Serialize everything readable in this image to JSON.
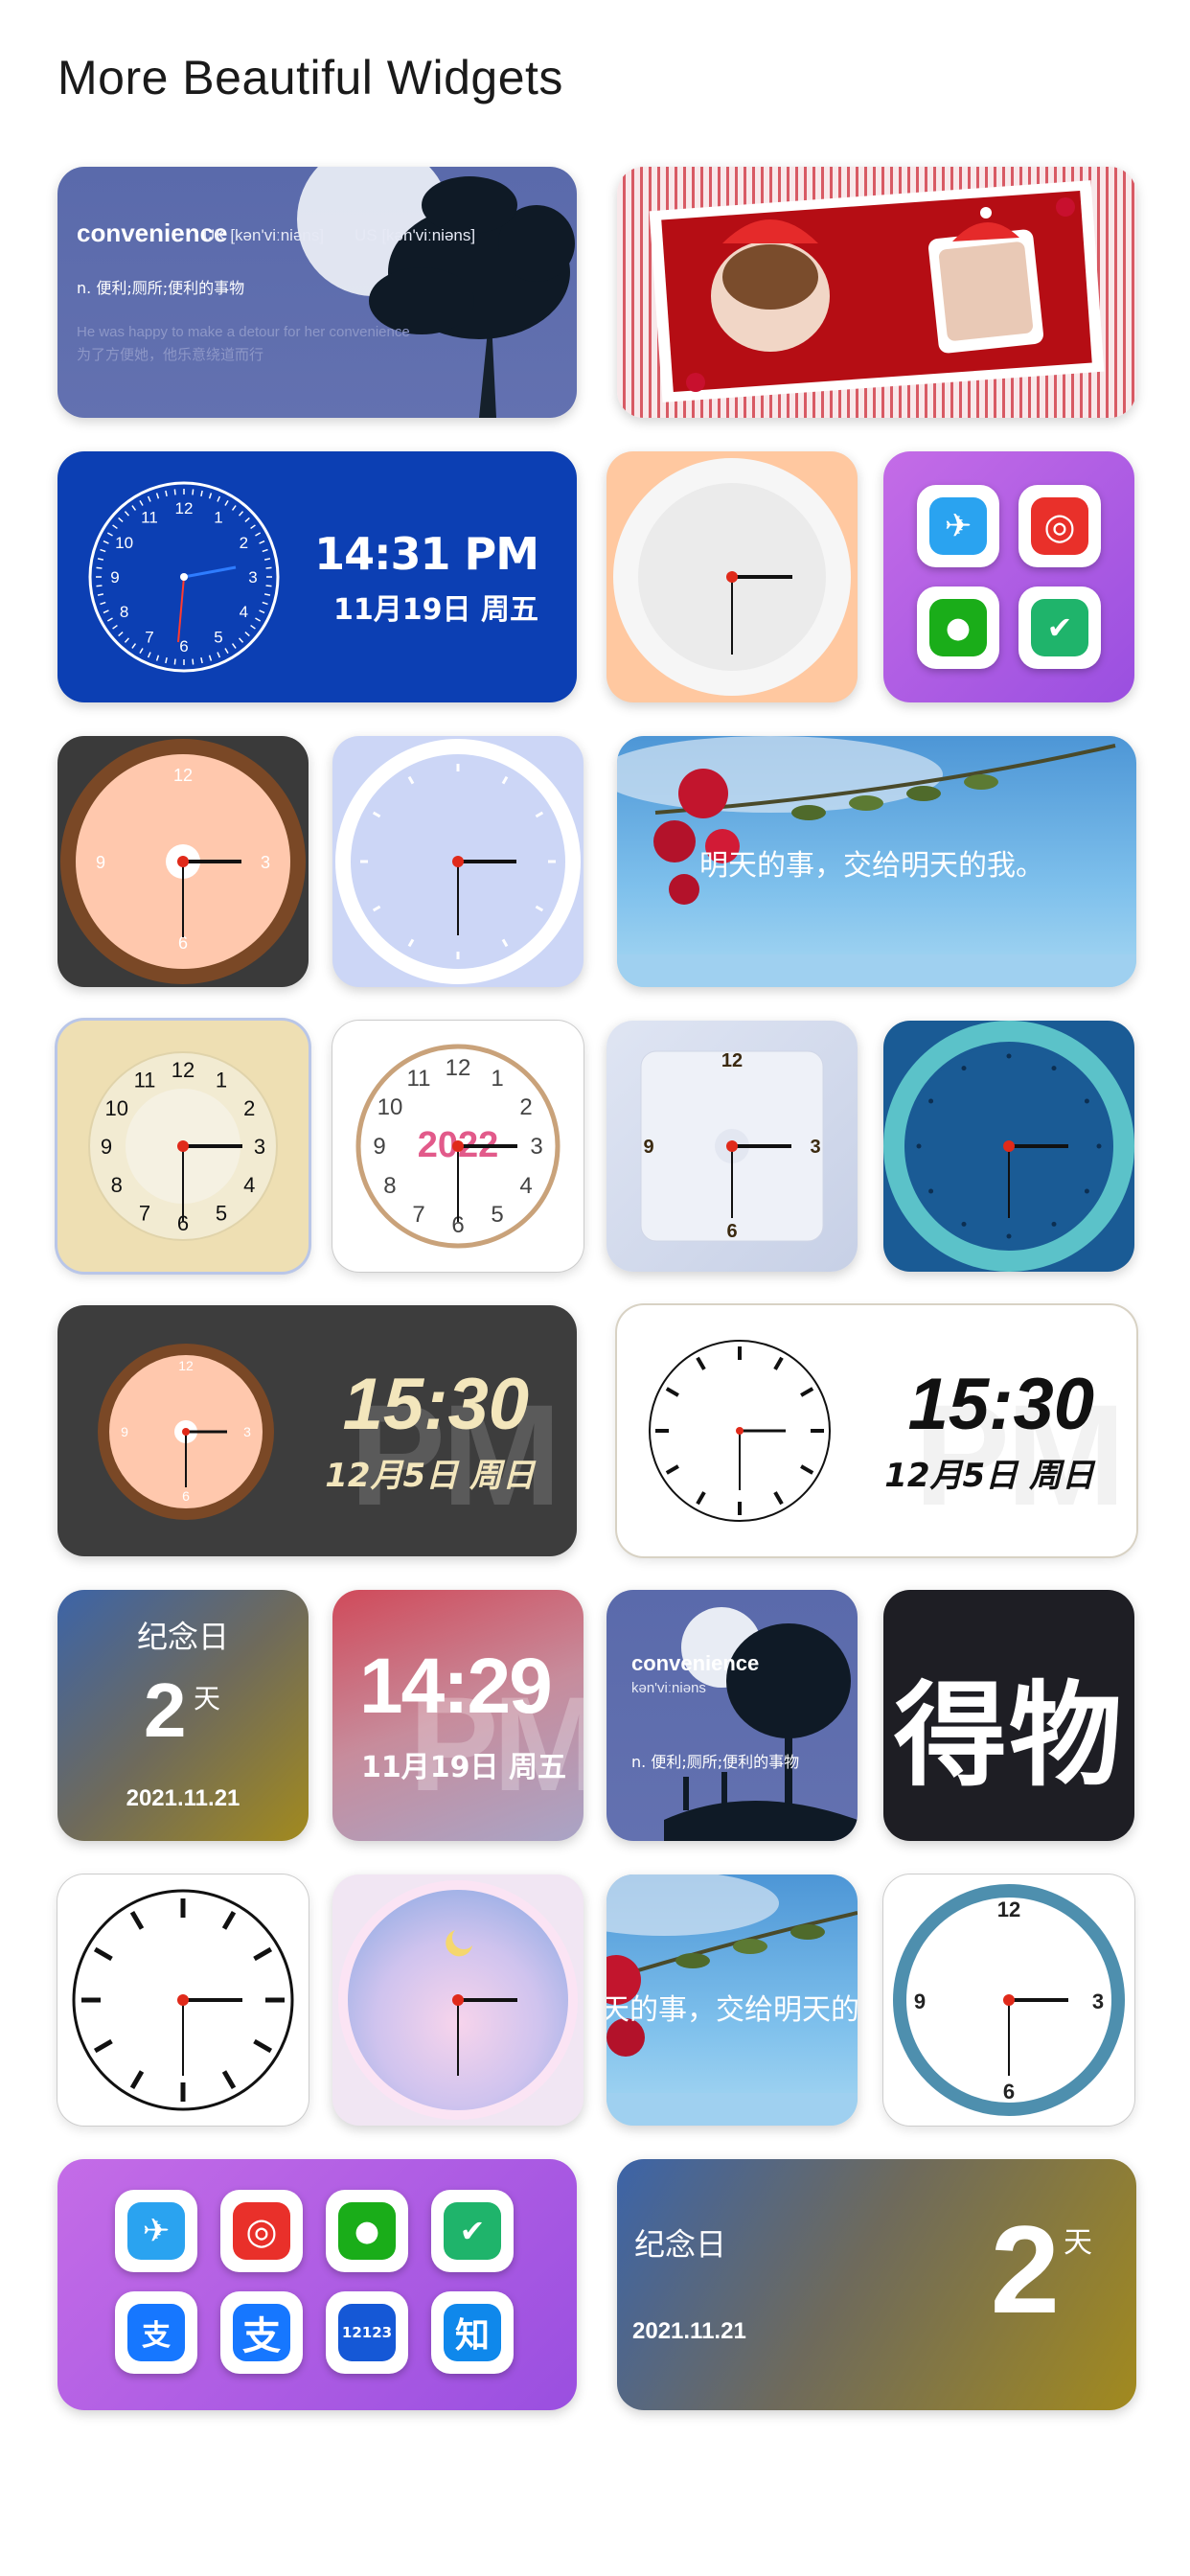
{
  "page": {
    "title": "More Beautiful Widgets"
  },
  "dictionary_widget": {
    "word": "convenience",
    "phonetic_uk": "UK [kən'viːniəns]",
    "phonetic_us": "US [kən'viːniəns]",
    "definition": "n. 便利;厕所;便利的事物",
    "example_en": "He was happy to make a detour for her convenience",
    "example_cn": "为了方便她，他乐意绕道而行"
  },
  "digital_clock_blue": {
    "time": "14:31 PM",
    "date": "11月19日 周五"
  },
  "quote_widget": {
    "text": "明天的事，交给明天的我。"
  },
  "quote_widget_small": {
    "text": "天的事，交给明天的我"
  },
  "wood_digital_clock": {
    "time": "15:30",
    "date": "12月5日 周日",
    "ampm": "PM"
  },
  "white_digital_clock": {
    "time": "15:30",
    "date": "12月5日 周日",
    "ampm": "PM"
  },
  "anniversary_small": {
    "label": "纪念日",
    "days": "2",
    "unit": "天",
    "date": "2021.11.21"
  },
  "gradient_clock": {
    "time": "14:29",
    "date": "11月19日 周五",
    "ampm": "PM"
  },
  "dictionary_small": {
    "word": "convenience",
    "phonetic": "kən'viːniəns",
    "definition": "n. 便利;厕所;便利的事物"
  },
  "dewu_widget": {
    "text": "得物"
  },
  "year_clock": {
    "overlay": "2022"
  },
  "app_icons_small": [
    {
      "name": "十一出行",
      "color": "#2aa3f0",
      "glyph": "✈"
    },
    {
      "name": "网易云音乐",
      "color": "#e9302a",
      "glyph": "◎"
    },
    {
      "name": "微信",
      "color": "#1aad19",
      "glyph": "●"
    },
    {
      "name": "企业微信",
      "color": "#1fb46b",
      "glyph": "✔"
    }
  ],
  "app_icons_large": [
    {
      "name": "十一出行",
      "color": "#2aa3f0",
      "glyph": "✈"
    },
    {
      "name": "网易云音乐",
      "color": "#e9302a",
      "glyph": "◎"
    },
    {
      "name": "微信",
      "color": "#1aad19",
      "glyph": "●"
    },
    {
      "name": "企业微信",
      "color": "#1fb46b",
      "glyph": "✔"
    },
    {
      "name": "扫一扫支",
      "color": "#1677ff",
      "glyph": "支"
    },
    {
      "name": "支付宝",
      "color": "#1677ff",
      "glyph": "支"
    },
    {
      "name": "12123",
      "color": "#1558d6",
      "glyph": "12123"
    },
    {
      "name": "知乎",
      "color": "#0f88eb",
      "glyph": "知"
    }
  ],
  "anniversary_large": {
    "label": "纪念日",
    "days": "2",
    "unit": "天",
    "date": "2021.11.21"
  },
  "clock_numerals": [
    "12",
    "1",
    "2",
    "3",
    "4",
    "5",
    "6",
    "7",
    "8",
    "9",
    "10",
    "11"
  ],
  "clock_numerals_quarter": [
    "12",
    "3",
    "6",
    "9"
  ]
}
